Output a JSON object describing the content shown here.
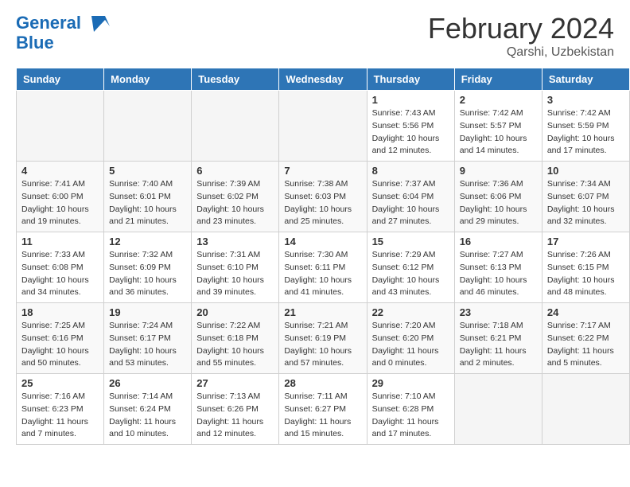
{
  "header": {
    "logo_line1": "General",
    "logo_line2": "Blue",
    "month_year": "February 2024",
    "location": "Qarshi, Uzbekistan"
  },
  "days_of_week": [
    "Sunday",
    "Monday",
    "Tuesday",
    "Wednesday",
    "Thursday",
    "Friday",
    "Saturday"
  ],
  "weeks": [
    [
      {
        "day": "",
        "empty": true
      },
      {
        "day": "",
        "empty": true
      },
      {
        "day": "",
        "empty": true
      },
      {
        "day": "",
        "empty": true
      },
      {
        "day": "1",
        "sunrise": "7:43 AM",
        "sunset": "5:56 PM",
        "daylight": "10 hours and 12 minutes."
      },
      {
        "day": "2",
        "sunrise": "7:42 AM",
        "sunset": "5:57 PM",
        "daylight": "10 hours and 14 minutes."
      },
      {
        "day": "3",
        "sunrise": "7:42 AM",
        "sunset": "5:59 PM",
        "daylight": "10 hours and 17 minutes."
      }
    ],
    [
      {
        "day": "4",
        "sunrise": "7:41 AM",
        "sunset": "6:00 PM",
        "daylight": "10 hours and 19 minutes."
      },
      {
        "day": "5",
        "sunrise": "7:40 AM",
        "sunset": "6:01 PM",
        "daylight": "10 hours and 21 minutes."
      },
      {
        "day": "6",
        "sunrise": "7:39 AM",
        "sunset": "6:02 PM",
        "daylight": "10 hours and 23 minutes."
      },
      {
        "day": "7",
        "sunrise": "7:38 AM",
        "sunset": "6:03 PM",
        "daylight": "10 hours and 25 minutes."
      },
      {
        "day": "8",
        "sunrise": "7:37 AM",
        "sunset": "6:04 PM",
        "daylight": "10 hours and 27 minutes."
      },
      {
        "day": "9",
        "sunrise": "7:36 AM",
        "sunset": "6:06 PM",
        "daylight": "10 hours and 29 minutes."
      },
      {
        "day": "10",
        "sunrise": "7:34 AM",
        "sunset": "6:07 PM",
        "daylight": "10 hours and 32 minutes."
      }
    ],
    [
      {
        "day": "11",
        "sunrise": "7:33 AM",
        "sunset": "6:08 PM",
        "daylight": "10 hours and 34 minutes."
      },
      {
        "day": "12",
        "sunrise": "7:32 AM",
        "sunset": "6:09 PM",
        "daylight": "10 hours and 36 minutes."
      },
      {
        "day": "13",
        "sunrise": "7:31 AM",
        "sunset": "6:10 PM",
        "daylight": "10 hours and 39 minutes."
      },
      {
        "day": "14",
        "sunrise": "7:30 AM",
        "sunset": "6:11 PM",
        "daylight": "10 hours and 41 minutes."
      },
      {
        "day": "15",
        "sunrise": "7:29 AM",
        "sunset": "6:12 PM",
        "daylight": "10 hours and 43 minutes."
      },
      {
        "day": "16",
        "sunrise": "7:27 AM",
        "sunset": "6:13 PM",
        "daylight": "10 hours and 46 minutes."
      },
      {
        "day": "17",
        "sunrise": "7:26 AM",
        "sunset": "6:15 PM",
        "daylight": "10 hours and 48 minutes."
      }
    ],
    [
      {
        "day": "18",
        "sunrise": "7:25 AM",
        "sunset": "6:16 PM",
        "daylight": "10 hours and 50 minutes."
      },
      {
        "day": "19",
        "sunrise": "7:24 AM",
        "sunset": "6:17 PM",
        "daylight": "10 hours and 53 minutes."
      },
      {
        "day": "20",
        "sunrise": "7:22 AM",
        "sunset": "6:18 PM",
        "daylight": "10 hours and 55 minutes."
      },
      {
        "day": "21",
        "sunrise": "7:21 AM",
        "sunset": "6:19 PM",
        "daylight": "10 hours and 57 minutes."
      },
      {
        "day": "22",
        "sunrise": "7:20 AM",
        "sunset": "6:20 PM",
        "daylight": "11 hours and 0 minutes."
      },
      {
        "day": "23",
        "sunrise": "7:18 AM",
        "sunset": "6:21 PM",
        "daylight": "11 hours and 2 minutes."
      },
      {
        "day": "24",
        "sunrise": "7:17 AM",
        "sunset": "6:22 PM",
        "daylight": "11 hours and 5 minutes."
      }
    ],
    [
      {
        "day": "25",
        "sunrise": "7:16 AM",
        "sunset": "6:23 PM",
        "daylight": "11 hours and 7 minutes."
      },
      {
        "day": "26",
        "sunrise": "7:14 AM",
        "sunset": "6:24 PM",
        "daylight": "11 hours and 10 minutes."
      },
      {
        "day": "27",
        "sunrise": "7:13 AM",
        "sunset": "6:26 PM",
        "daylight": "11 hours and 12 minutes."
      },
      {
        "day": "28",
        "sunrise": "7:11 AM",
        "sunset": "6:27 PM",
        "daylight": "11 hours and 15 minutes."
      },
      {
        "day": "29",
        "sunrise": "7:10 AM",
        "sunset": "6:28 PM",
        "daylight": "11 hours and 17 minutes."
      },
      {
        "day": "",
        "empty": true
      },
      {
        "day": "",
        "empty": true
      }
    ]
  ]
}
